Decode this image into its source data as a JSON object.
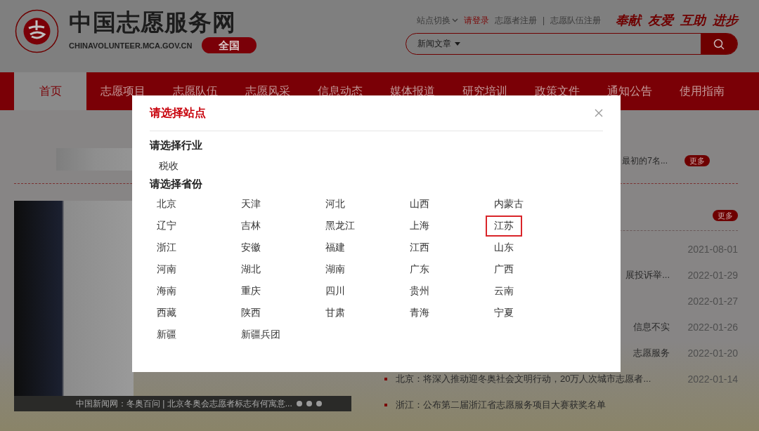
{
  "header": {
    "site_title": "中国志愿服务网",
    "domain": "CHINAVOLUNTEER.MCA.GOV.CN",
    "scope_badge": "全国",
    "top_links": [
      {
        "kind": "dropdown",
        "label": "站点切换"
      },
      {
        "kind": "login",
        "label": "请登录"
      },
      {
        "kind": "link",
        "label": "志愿者注册"
      },
      {
        "kind": "separator",
        "label": "|"
      },
      {
        "kind": "link",
        "label": "志愿队伍注册"
      }
    ],
    "slogan": [
      "奉献",
      "友爱",
      "互助",
      "进步"
    ],
    "search": {
      "category": "新闻文章"
    }
  },
  "nav": {
    "items": [
      {
        "label": "首页",
        "selected": true
      },
      {
        "label": "志愿项目",
        "selected": false
      },
      {
        "label": "志愿队伍",
        "selected": false
      },
      {
        "label": "志愿风采",
        "selected": false
      },
      {
        "label": "信息动态",
        "selected": false
      },
      {
        "label": "媒体报道",
        "selected": false
      },
      {
        "label": "研究培训",
        "selected": false
      },
      {
        "label": "政策文件",
        "selected": false
      },
      {
        "label": "通知公告",
        "selected": false
      },
      {
        "label": "使用指南",
        "selected": false
      }
    ]
  },
  "featured": {
    "snippet": "最初的7名...",
    "more": "更多"
  },
  "photo": {
    "caption": "中国新闻网：冬奥百问 | 北京冬奥会志愿者标志有何寓意..."
  },
  "news": {
    "more": "更多",
    "rows": [
      {
        "kind": "partial",
        "date": "2021-08-01"
      },
      {
        "kind": "partial",
        "title": "展投诉举...",
        "date": "2022-01-29"
      },
      {
        "kind": "partial",
        "date": "2022-01-27"
      },
      {
        "kind": "partial",
        "title": "信息不实",
        "date": "2022-01-26"
      },
      {
        "kind": "partial",
        "title": "志愿服务",
        "date": "2022-01-20"
      },
      {
        "kind": "full",
        "title": "北京：将深入推动迎冬奥社会文明行动，20万人次城市志愿者...",
        "date": "2022-01-14"
      },
      {
        "kind": "full",
        "title": "浙江：公布第二届浙江省志愿服务项目大赛获奖名单"
      }
    ]
  },
  "modal": {
    "title": "请选择站点",
    "industry_heading": "请选择行业",
    "industries": [
      {
        "label": "税收"
      }
    ],
    "province_heading": "请选择省份",
    "provinces": [
      {
        "label": "北京",
        "selected": false
      },
      {
        "label": "天津",
        "selected": false
      },
      {
        "label": "河北",
        "selected": false
      },
      {
        "label": "山西",
        "selected": false
      },
      {
        "label": "内蒙古",
        "selected": false
      },
      {
        "label": "辽宁",
        "selected": false
      },
      {
        "label": "吉林",
        "selected": false
      },
      {
        "label": "黑龙江",
        "selected": false
      },
      {
        "label": "上海",
        "selected": false
      },
      {
        "label": "江苏",
        "selected": true
      },
      {
        "label": "浙江",
        "selected": false
      },
      {
        "label": "安徽",
        "selected": false
      },
      {
        "label": "福建",
        "selected": false
      },
      {
        "label": "江西",
        "selected": false
      },
      {
        "label": "山东",
        "selected": false
      },
      {
        "label": "河南",
        "selected": false
      },
      {
        "label": "湖北",
        "selected": false
      },
      {
        "label": "湖南",
        "selected": false
      },
      {
        "label": "广东",
        "selected": false
      },
      {
        "label": "广西",
        "selected": false
      },
      {
        "label": "海南",
        "selected": false
      },
      {
        "label": "重庆",
        "selected": false
      },
      {
        "label": "四川",
        "selected": false
      },
      {
        "label": "贵州",
        "selected": false
      },
      {
        "label": "云南",
        "selected": false
      },
      {
        "label": "西藏",
        "selected": false
      },
      {
        "label": "陕西",
        "selected": false
      },
      {
        "label": "甘肃",
        "selected": false
      },
      {
        "label": "青海",
        "selected": false
      },
      {
        "label": "宁夏",
        "selected": false
      },
      {
        "label": "新疆",
        "selected": false
      },
      {
        "label": "新疆兵团",
        "selected": false
      }
    ]
  }
}
